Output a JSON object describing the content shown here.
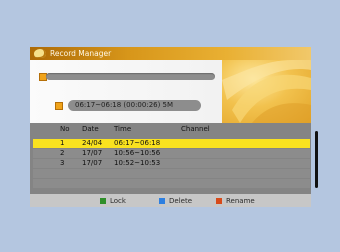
{
  "window": {
    "title": "Record Manager"
  },
  "recording": {
    "time_range": "06:17~06:18 (00:00:26) 5M"
  },
  "table": {
    "headers": {
      "no": "No",
      "date": "Date",
      "time": "Time",
      "channel": "Channel"
    },
    "rows": [
      {
        "no": "1",
        "date": "24/04",
        "time": "06:17~06:18",
        "channel": ""
      },
      {
        "no": "2",
        "date": "17/07",
        "time": "10:56~10:56",
        "channel": ""
      },
      {
        "no": "3",
        "date": "17/07",
        "time": "10:52~10:53",
        "channel": ""
      }
    ]
  },
  "legend": [
    {
      "label": "Lock",
      "color": "#2f8f2a"
    },
    {
      "label": "Delete",
      "color": "#2d7fe0"
    },
    {
      "label": "Rename",
      "color": "#d74a1a"
    }
  ],
  "colors": {
    "selected_row": "#f9e21f",
    "accent": "#e9b033"
  }
}
